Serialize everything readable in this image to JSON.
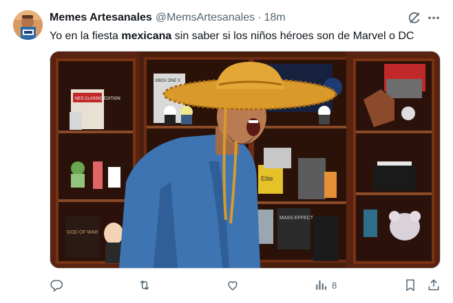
{
  "author": {
    "display_name": "Memes Artesanales",
    "handle": "@MemsArtesanales",
    "separator": "·",
    "time": "18m"
  },
  "tweet": {
    "text_before": "Yo en la fiesta ",
    "text_bold": "mexicana",
    "text_after": " sin saber si los niños héroes son de Marvel o DC"
  },
  "media": {
    "shelf_labels": {
      "box_label": "NES CLASSIC EDITION",
      "console_label": "XBOX ONE X",
      "game_label": "MASS EFFECT",
      "game_label2": "GOD OF WAR",
      "yellow_box": "Elite"
    }
  },
  "actions": {
    "views_count": "8"
  },
  "icons": {
    "header": [
      "grok-icon",
      "more-icon"
    ],
    "actions": [
      "reply-icon",
      "retweet-icon",
      "like-icon",
      "views-icon",
      "bookmark-icon",
      "share-icon"
    ]
  },
  "colors": {
    "text_primary": "#0f1419",
    "text_secondary": "#536471",
    "border": "#cfd9de"
  }
}
